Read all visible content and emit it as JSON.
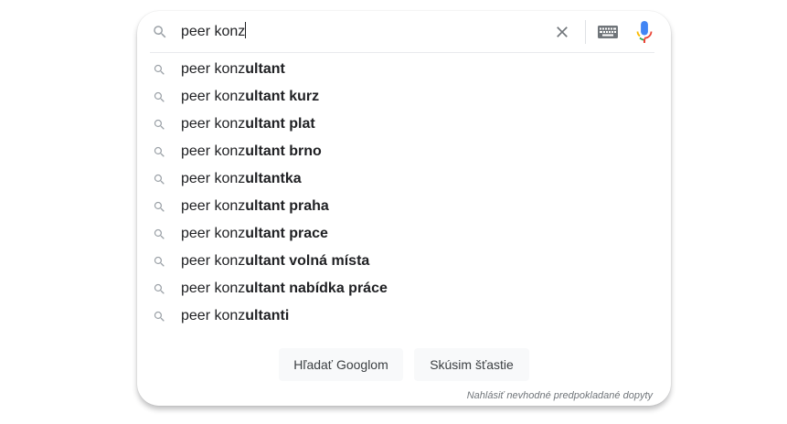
{
  "search": {
    "query": "peer konz"
  },
  "suggestions": [
    {
      "prefix": "peer konz",
      "completion": "ultant"
    },
    {
      "prefix": "peer konz",
      "completion": "ultant kurz"
    },
    {
      "prefix": "peer konz",
      "completion": "ultant plat"
    },
    {
      "prefix": "peer konz",
      "completion": "ultant brno"
    },
    {
      "prefix": "peer konz",
      "completion": "ultantka"
    },
    {
      "prefix": "peer konz",
      "completion": "ultant praha"
    },
    {
      "prefix": "peer konz",
      "completion": "ultant prace"
    },
    {
      "prefix": "peer konz",
      "completion": "ultant volná místa"
    },
    {
      "prefix": "peer konz",
      "completion": "ultant nabídka práce"
    },
    {
      "prefix": "peer konz",
      "completion": "ultanti"
    }
  ],
  "buttons": {
    "search": "Hľadať Googlom",
    "lucky": "Skúsim šťastie"
  },
  "report_link": "Nahlásiť nevhodné predpokladané dopyty",
  "icons": {
    "search": "search-icon",
    "clear": "close-icon",
    "keyboard": "keyboard-icon",
    "voice": "microphone-icon"
  },
  "colors": {
    "icon_gray": "#9aa0a6",
    "text": "#202124",
    "mic_blue": "#4285f4",
    "mic_red": "#ea4335",
    "mic_yellow": "#fbbc04",
    "mic_green": "#34a853"
  }
}
